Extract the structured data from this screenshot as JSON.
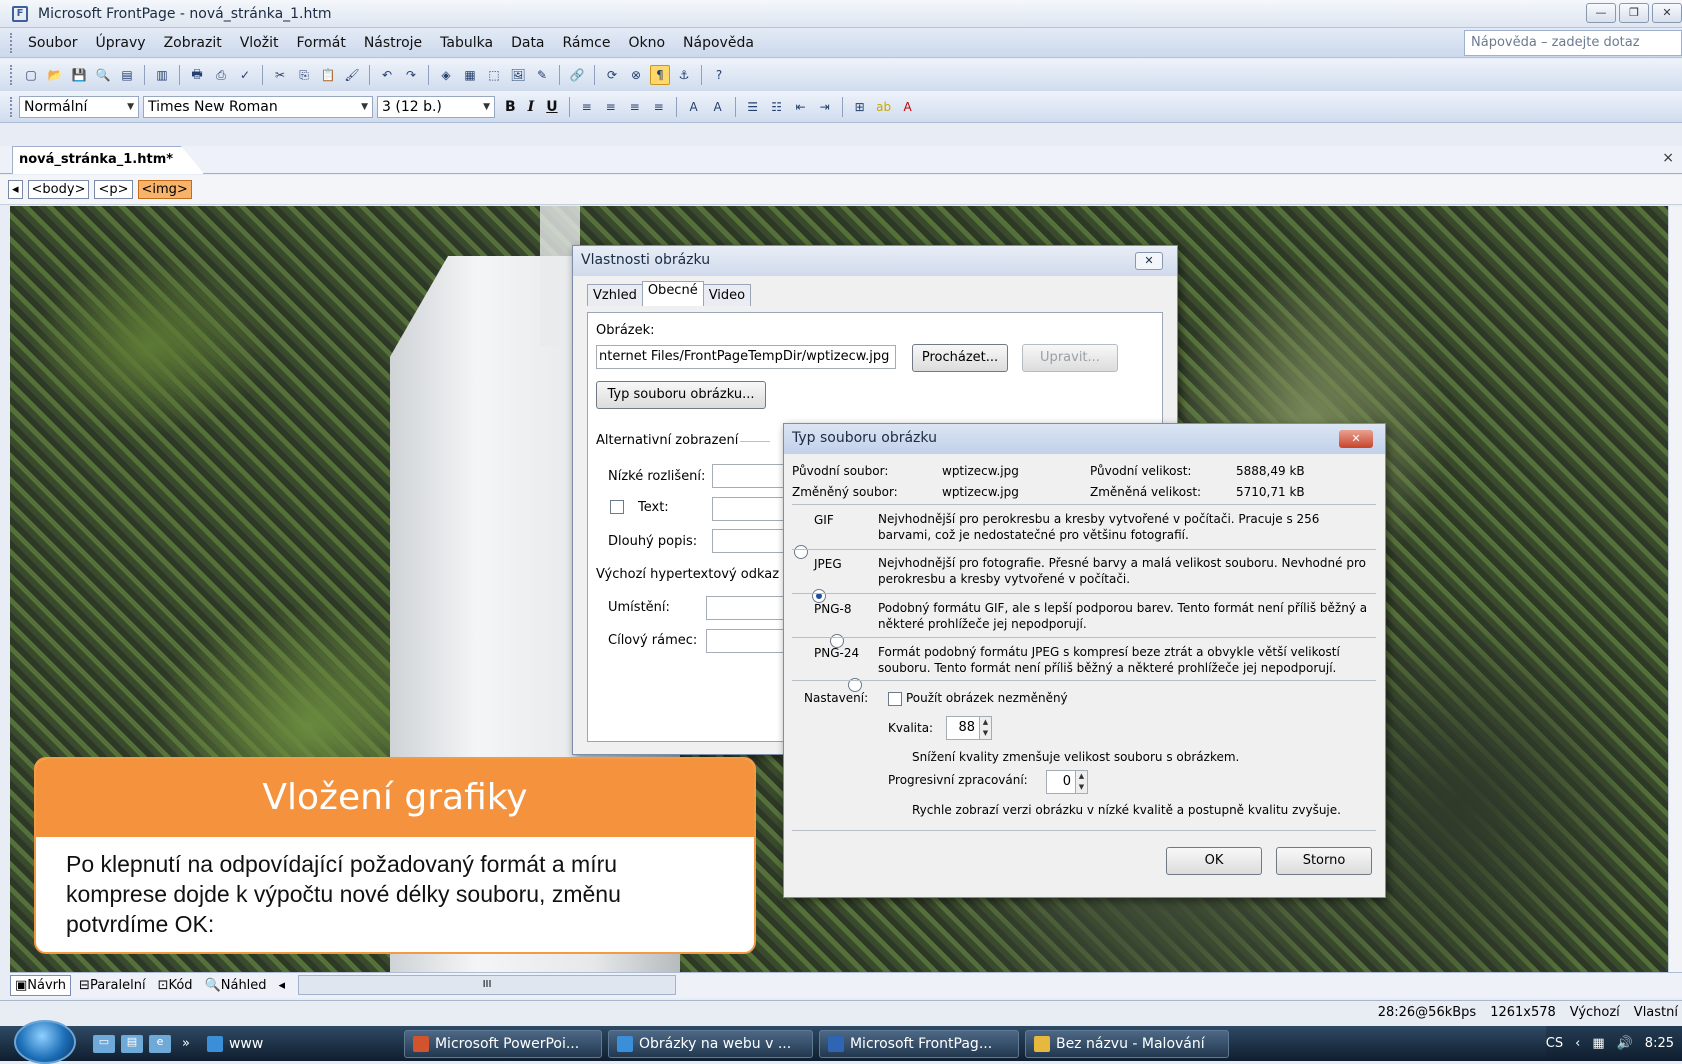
{
  "window": {
    "title": "Microsoft FrontPage - nová_stránka_1.htm",
    "controls": [
      "minimize",
      "restore",
      "close"
    ]
  },
  "menu": {
    "items": [
      "Soubor",
      "Úpravy",
      "Zobrazit",
      "Vložit",
      "Formát",
      "Nástroje",
      "Tabulka",
      "Data",
      "Rámce",
      "Okno",
      "Nápověda"
    ],
    "help_placeholder": "Nápověda – zadejte dotaz"
  },
  "format_toolbar": {
    "style": "Normální",
    "font": "Times New Roman",
    "size": "3 (12 b.)",
    "bold": "B",
    "italic": "I",
    "underline": "U"
  },
  "document": {
    "tab": "nová_stránka_1.htm*",
    "close": "×",
    "tags": [
      "<body>",
      "<p>",
      "<img>"
    ]
  },
  "props_dialog": {
    "title": "Vlastnosti obrázku",
    "tabs": [
      "Vzhled",
      "Obecné",
      "Video"
    ],
    "image_label": "Obrázek:",
    "image_path": "nternet Files/FrontPageTempDir/wptizecw.jpg",
    "browse": "Procházet...",
    "edit": "Upravit...",
    "filetype": "Typ souboru obrázku...",
    "alt_group": "Alternativní zobrazení",
    "low_res": "Nízké rozlišení:",
    "text": "Text:",
    "long_desc": "Dlouhý popis:",
    "hyperlink_group": "Výchozí hypertextový odkaz",
    "location": "Umístění:",
    "target": "Cílový rámec:"
  },
  "filetype_dialog": {
    "title": "Typ souboru obrázku",
    "orig_file_label": "Původní soubor:",
    "orig_file": "wptizecw.jpg",
    "orig_size_label": "Původní velikost:",
    "orig_size": "5888,49 kB",
    "changed_file_label": "Změněný soubor:",
    "changed_file": "wptizecw.jpg",
    "changed_size_label": "Změněná velikost:",
    "changed_size": "5710,71 kB",
    "formats": [
      {
        "label": "GIF",
        "desc": "Nejvhodnější pro perokresbu a kresby vytvořené v počítači. Pracuje s 256 barvami, což je nedostatečné pro většinu fotografií.",
        "selected": false
      },
      {
        "label": "JPEG",
        "desc": "Nejvhodnější pro fotografie. Přesné barvy a malá velikost souboru. Nevhodné pro perokresbu a kresby vytvořené v počítači.",
        "selected": true
      },
      {
        "label": "PNG-8",
        "desc": "Podobný formátu GIF, ale s lepší podporou barev. Tento formát není příliš běžný a některé prohlížeče jej nepodporují.",
        "selected": false
      },
      {
        "label": "PNG-24",
        "desc": "Formát podobný formátu JPEG s kompresí beze ztrát a obvykle větší velikostí souboru. Tento formát není příliš běžný a některé prohlížeče jej nepodporují.",
        "selected": false
      }
    ],
    "settings_label": "Nastavení:",
    "use_unchanged": "Použít obrázek nezměněný",
    "quality_label": "Kvalita:",
    "quality": "88",
    "quality_note": "Snížení kvality zmenšuje velikost souboru s obrázkem.",
    "progressive_label": "Progresivní zpracování:",
    "progressive": "0",
    "progressive_note": "Rychle zobrazí verzi obrázku v nízké kvalitě a postupně kvalitu zvyšuje.",
    "ok": "OK",
    "cancel": "Storno"
  },
  "callout": {
    "title": "Vložení grafiky",
    "text": "Po klepnutí na odpovídající požadovaný formát  a míru komprese dojde k výpočtu nové délky souboru, změnu potvrdíme OK:"
  },
  "views": [
    "Návrh",
    "Paralelní",
    "Kód",
    "Náhled"
  ],
  "scroll_mark": "III",
  "status": {
    "speed": "28:26@56kBps",
    "size": "1261x578",
    "style": "Výchozí",
    "custom": "Vlastní"
  },
  "taskbar": {
    "quick_more": "»",
    "items": [
      "www",
      "Microsoft PowerPoi...",
      "Obrázky na webu v ...",
      "Microsoft FrontPag...",
      "Bez názvu - Malování"
    ],
    "lang": "CS",
    "time": "8:25"
  }
}
